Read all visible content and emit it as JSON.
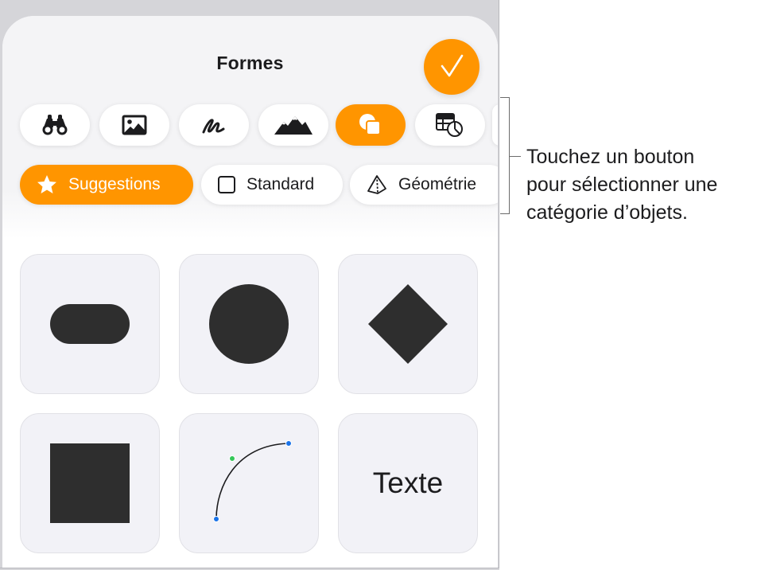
{
  "sheet": {
    "title": "Formes",
    "done_button": {
      "icon": "checkmark-icon",
      "color": "#ff9500"
    }
  },
  "categories": [
    {
      "icon": "binoculars-icon",
      "active": false
    },
    {
      "icon": "photo-icon",
      "active": false
    },
    {
      "icon": "drawing-icon",
      "active": false
    },
    {
      "icon": "mountains-icon",
      "active": false
    },
    {
      "icon": "shapes-icon",
      "active": true
    },
    {
      "icon": "table-chart-icon",
      "active": false
    }
  ],
  "tabs": [
    {
      "label": "Suggestions",
      "icon": "star-icon",
      "active": true
    },
    {
      "label": "Standard",
      "icon": "square-outline-icon",
      "active": false
    },
    {
      "label": "Géométrie",
      "icon": "pyramid-icon",
      "active": false
    }
  ],
  "shapes": [
    {
      "name": "rounded-rectangle"
    },
    {
      "name": "circle"
    },
    {
      "name": "diamond"
    },
    {
      "name": "square"
    },
    {
      "name": "curve"
    },
    {
      "name": "text",
      "label": "Texte"
    }
  ],
  "callout": {
    "line1": "Touchez un bouton",
    "line2": "pour sélectionner une",
    "line3": "catégorie d’objets."
  },
  "colors": {
    "accent": "#ff9500",
    "shape_fill": "#2e2e2e",
    "tile_bg": "#f2f2f7"
  }
}
